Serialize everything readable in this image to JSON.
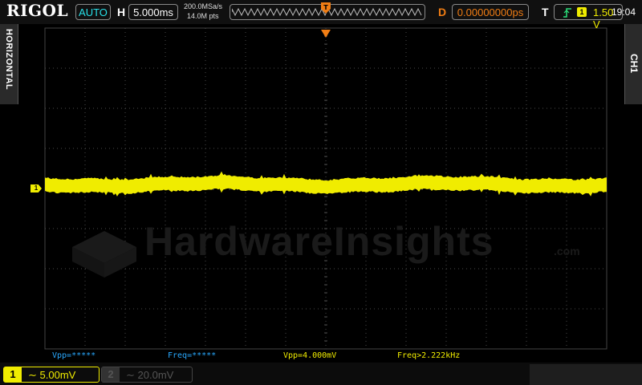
{
  "brand": "RIGOL",
  "top": {
    "run_mode": "AUTO",
    "horizontal_label": "H",
    "timebase": "5.000ms",
    "sample_rate": "200.0MSa/s",
    "memory_depth": "14.0M pts",
    "delay_label": "D",
    "delay": "0.00000000ps",
    "trigger_label": "T",
    "trigger_source": "1",
    "trigger_level": "1.50 V"
  },
  "side": {
    "left_tab": "HORIZONTAL",
    "right_tab": "CH1"
  },
  "channel_marker": "1",
  "measurements": [
    "Vpp=*****",
    "Freq=*****",
    "Vpp=4.000mV",
    "Freq>2.222kHz"
  ],
  "channels": {
    "ch1": {
      "number": "1",
      "scale": "5.00mV"
    },
    "ch2": {
      "number": "2",
      "scale": "20.0mV"
    }
  },
  "watermark": {
    "text": "HardwareInsights",
    "suffix": ".com"
  },
  "clock": "19:04",
  "colors": {
    "ch1": "#f0ec00",
    "accent": "#28e1e9",
    "trigger": "#f07d14",
    "grid": "#3c3c3c"
  }
}
